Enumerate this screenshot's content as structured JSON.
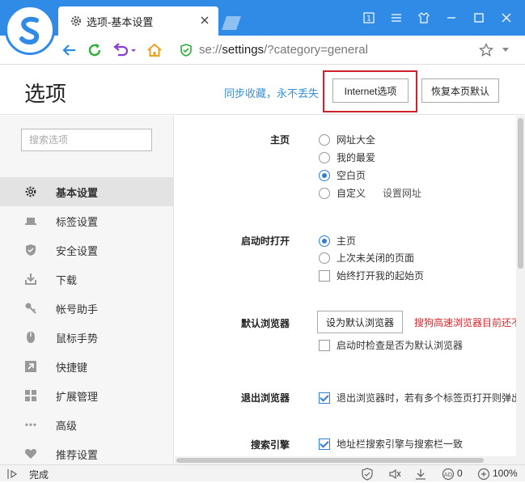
{
  "tab": {
    "title": "选项-基本设置"
  },
  "address": {
    "scheme": "se://",
    "host": "settings",
    "path": "/?category=general"
  },
  "header": {
    "title": "选项",
    "sync_link": "同步收藏，永不丢失",
    "internet_button": "Internet选项",
    "restore_button": "恢复本页默认"
  },
  "sidebar": {
    "search_placeholder": "搜索选项",
    "items": [
      {
        "label": "基本设置",
        "icon": "gear-icon"
      },
      {
        "label": "标签设置",
        "icon": "laptop-icon"
      },
      {
        "label": "安全设置",
        "icon": "shield-icon"
      },
      {
        "label": "下载",
        "icon": "download-icon"
      },
      {
        "label": "帐号助手",
        "icon": "key-icon"
      },
      {
        "label": "鼠标手势",
        "icon": "mouse-icon"
      },
      {
        "label": "快捷键",
        "icon": "shortcut-icon"
      },
      {
        "label": "扩展管理",
        "icon": "grid-icon"
      },
      {
        "label": "高级",
        "icon": "more-icon"
      },
      {
        "label": "推荐设置",
        "icon": "heart-icon"
      }
    ]
  },
  "settings": {
    "homepage": {
      "label": "主页",
      "options": [
        "网址大全",
        "我的最爱",
        "空白页",
        "自定义"
      ],
      "selected": "空白页",
      "set_url_link": "设置网址"
    },
    "startup": {
      "label": "启动时打开",
      "options": [
        "主页",
        "上次未关闭的页面"
      ],
      "selected": "主页",
      "always_open": "始终打开我的起始页"
    },
    "default_browser": {
      "label": "默认浏览器",
      "button": "设为默认浏览器",
      "warning": "搜狗高速浏览器目前还不",
      "check_on_start": "启动时检查是否为默认浏览器"
    },
    "exit": {
      "label": "退出浏览器",
      "option": "退出浏览器时，若有多个标签页打开则弹出"
    },
    "search": {
      "label": "搜索引擎",
      "option": "地址栏搜索引擎与搜索栏一致"
    }
  },
  "status": {
    "text": "完成",
    "count": "0",
    "zoom": "100%"
  },
  "colors": {
    "accent": "#2f8be6",
    "warning": "#e0262c",
    "highlight_box": "#d0202a"
  }
}
